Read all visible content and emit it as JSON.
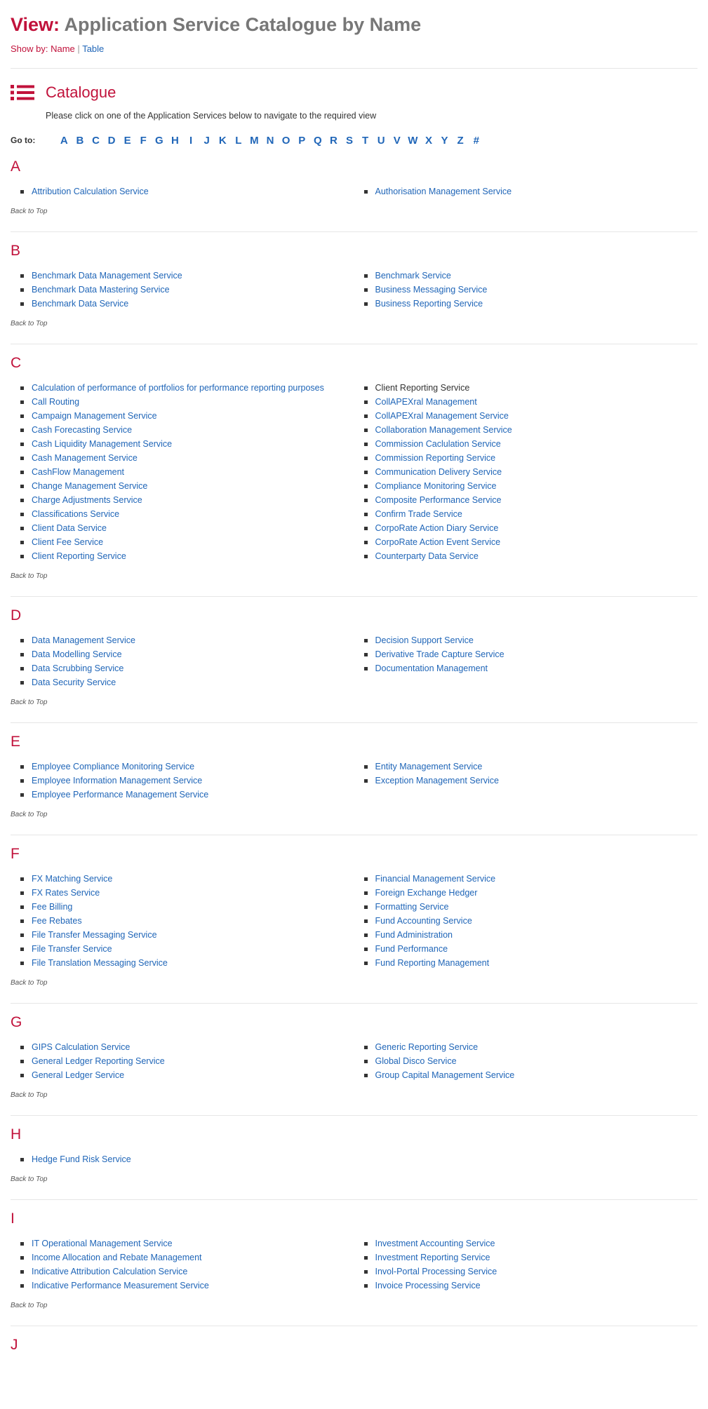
{
  "header": {
    "view_label": "View:",
    "title": "Application Service Catalogue by Name",
    "show_by_label": "Show by:",
    "show_by_current": "Name",
    "separator": "|",
    "show_by_table": "Table"
  },
  "catalogue": {
    "icon": "list-icon",
    "title": "Catalogue",
    "description": "Please click on one of the Application Services below to navigate to the required view"
  },
  "goto": {
    "label": "Go to:",
    "letters": [
      "A",
      "B",
      "C",
      "D",
      "E",
      "F",
      "G",
      "H",
      "I",
      "J",
      "K",
      "L",
      "M",
      "N",
      "O",
      "P",
      "Q",
      "R",
      "S",
      "T",
      "U",
      "V",
      "W",
      "X",
      "Y",
      "Z",
      "#"
    ]
  },
  "back_to_top": "Back to Top",
  "sections": [
    {
      "letter": "A",
      "left": [
        "Attribution Calculation Service"
      ],
      "right": [
        "Authorisation Management Service"
      ]
    },
    {
      "letter": "B",
      "left": [
        "Benchmark Data Management Service",
        "Benchmark Data Mastering Service",
        "Benchmark Data Service"
      ],
      "right": [
        "Benchmark Service",
        "Business Messaging Service",
        "Business Reporting Service"
      ]
    },
    {
      "letter": "C",
      "left": [
        "Calculation of performance of portfolios for performance reporting purposes",
        "Call Routing",
        "Campaign Management Service",
        "Cash Forecasting Service",
        "Cash Liquidity Management Service",
        "Cash Management Service",
        "CashFlow Management",
        "Change Management Service",
        "Charge Adjustments Service",
        "Classifications Service",
        "Client Data Service",
        "Client Fee Service",
        "Client Reporting Service"
      ],
      "right": [
        "Client Reporting Service",
        "CollAPEXral Management",
        "CollAPEXral Management Service",
        "Collaboration Management Service",
        "Commission Caclulation Service",
        "Commission Reporting Service",
        "Communication Delivery Service",
        "Compliance Monitoring Service",
        "Composite Performance Service",
        "Confirm Trade Service",
        "CorpoRate Action Diary Service",
        "CorpoRate Action Event Service",
        "Counterparty Data Service"
      ],
      "plain_right": [
        0
      ]
    },
    {
      "letter": "D",
      "left": [
        "Data Management Service",
        "Data Modelling Service",
        "Data Scrubbing Service",
        "Data Security Service"
      ],
      "right": [
        "Decision Support Service",
        "Derivative Trade Capture Service",
        "Documentation Management"
      ]
    },
    {
      "letter": "E",
      "left": [
        "Employee Compliance Monitoring Service",
        "Employee Information Management Service",
        "Employee Performance Management Service"
      ],
      "right": [
        "Entity Management Service",
        "Exception Management Service"
      ]
    },
    {
      "letter": "F",
      "left": [
        "FX Matching Service",
        "FX Rates Service",
        "Fee Billing",
        "Fee Rebates",
        "File Transfer Messaging Service",
        "File Transfer Service",
        "File Translation Messaging Service"
      ],
      "right": [
        "Financial Management Service",
        "Foreign Exchange Hedger",
        "Formatting Service",
        "Fund Accounting Service",
        "Fund Administration",
        "Fund Performance",
        "Fund Reporting Management"
      ]
    },
    {
      "letter": "G",
      "left": [
        "GIPS Calculation Service",
        "General Ledger Reporting Service",
        "General Ledger Service"
      ],
      "right": [
        "Generic Reporting Service",
        "Global Disco Service",
        "Group Capital Management Service"
      ]
    },
    {
      "letter": "H",
      "left": [
        "Hedge Fund Risk Service"
      ],
      "right": []
    },
    {
      "letter": "I",
      "left": [
        "IT Operational Management Service",
        "Income Allocation and Rebate Management",
        "Indicative Attribution Calculation Service",
        "Indicative Performance Measurement Service"
      ],
      "right": [
        "Investment Accounting Service",
        "Investment Reporting Service",
        "Invol-Portal Processing Service",
        "Invoice Processing Service"
      ]
    },
    {
      "letter": "J",
      "left": [],
      "right": []
    }
  ]
}
